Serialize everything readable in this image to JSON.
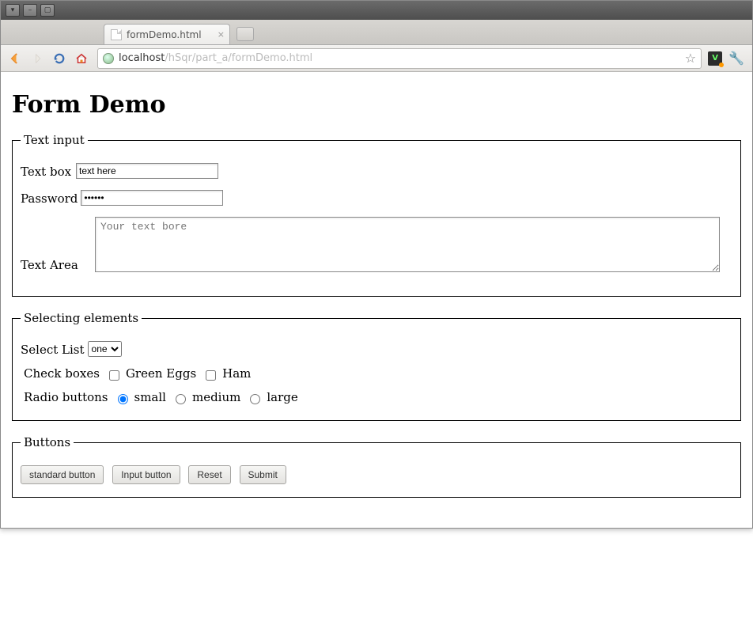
{
  "window": {
    "tab_title": "formDemo.html",
    "url_host": "localhost",
    "url_path": "/hSqr/part_a/formDemo.html"
  },
  "page": {
    "heading": "Form Demo",
    "fieldset_text": {
      "legend": "Text input",
      "textbox_label": "Text box",
      "textbox_value": "text here",
      "password_label": "Password",
      "password_value": "••••••",
      "textarea_label": "Text Area",
      "textarea_placeholder": "Your text bore"
    },
    "fieldset_select": {
      "legend": "Selecting elements",
      "select_label": "Select List",
      "select_value": "one",
      "checkbox_label": "Check boxes",
      "checkbox_options": {
        "green_eggs": "Green Eggs",
        "ham": "Ham"
      },
      "radio_label": "Radio buttons",
      "radio_options": {
        "small": "small",
        "medium": "medium",
        "large": "large"
      }
    },
    "fieldset_buttons": {
      "legend": "Buttons",
      "standard": "standard button",
      "input": "Input button",
      "reset": "Reset",
      "submit": "Submit"
    }
  }
}
